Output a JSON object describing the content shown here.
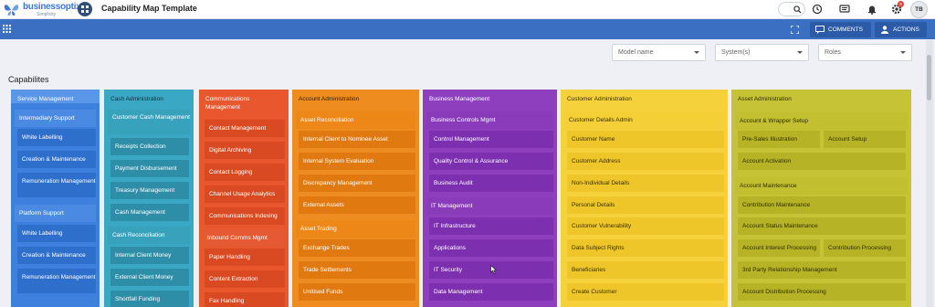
{
  "header": {
    "logo_text": "businessoptix",
    "logo_sub": "Simplicity",
    "page_title": "Capability Map Template",
    "user_initials": "TB",
    "notification_badge": "8"
  },
  "toolbar": {
    "comments_label": "COMMENTS",
    "actions_label": "ACTIONS"
  },
  "filters": {
    "model": "Model name",
    "systems": "System(s)",
    "roles": "Roles"
  },
  "section_title": "Capabilites",
  "colors": {
    "service": "#3d80de",
    "cash": "#3aa8c4",
    "comms": "#e8572e",
    "account_admin": "#ef8c1f",
    "business": "#8d3fbd",
    "customer": "#f5d23b",
    "asset": "#c6c336",
    "top_bar": "#3b6fc2"
  },
  "columns": {
    "service": {
      "title": "Service Management",
      "groups": [
        "Intermediary Support",
        "Platform Support"
      ],
      "items": [
        "White Labelling",
        "Creation & Maintenance",
        "Remuneration Management",
        "White Labelling",
        "Creation & Maintenance",
        "Remuneration Management"
      ]
    },
    "cash": {
      "title": "Cash Administration",
      "groups": [
        "Customer Cash Management",
        "Cash Reconciliation"
      ],
      "items": [
        "Receipts Collection",
        "Payment Disbursement",
        "Treasury Management",
        "Cash Management",
        "Internal Client Money",
        "External Client Money",
        "Shortfall Funding"
      ]
    },
    "comms": {
      "title": "Communications Management",
      "items": [
        "Contact Management",
        "Digital Archiving",
        "Contact Logging",
        "Channel Usage Analytics",
        "Communications Indexing"
      ],
      "groups": [
        "Inbound Comms Mgmt"
      ],
      "items2": [
        "Paper Handling",
        "Content Extraction",
        "Fax Handling"
      ]
    },
    "account_admin": {
      "title": "Account Administration",
      "groups": [
        "Asset Reconciliation",
        "Asset Trading"
      ],
      "items": [
        "Internal Client to Nominee Asset",
        "Internal System Evaluation",
        "Discrepancy Management",
        "External Assets",
        "Exchange Trades",
        "Trade Settlements",
        "Unitised Funds"
      ]
    },
    "business": {
      "title": "Business Management",
      "groups": [
        "Business Controls Mgmt",
        "IT Management"
      ],
      "items": [
        "Control Management",
        "Quality Control & Assurance",
        "Business Audit",
        "IT Infrastructure",
        "Applications",
        "IT Security",
        "Data Management"
      ]
    },
    "customer": {
      "title": "Customer Administration",
      "groups": [
        "Customer Details Admin"
      ],
      "items": [
        "Customer Name",
        "Customer Address",
        "Non-Individual Details",
        "Personal Details",
        "Customer Vulnerability",
        "Data Subject Rights",
        "Beneficiaries",
        "Create Customer"
      ]
    },
    "asset": {
      "title": "Asset Administration",
      "groups": [
        "Account & Wrapper Setup",
        "Account Maintenance"
      ],
      "items": [
        "Pre-Sales Illustration",
        "Account Setup",
        "Account Activation",
        "Contribution Maintenance",
        "Account Status Maintenance",
        "Account Interest Processing",
        "Contribution Processing",
        "3rd Party Relationship Management",
        "Account Distribution Processing"
      ]
    }
  }
}
